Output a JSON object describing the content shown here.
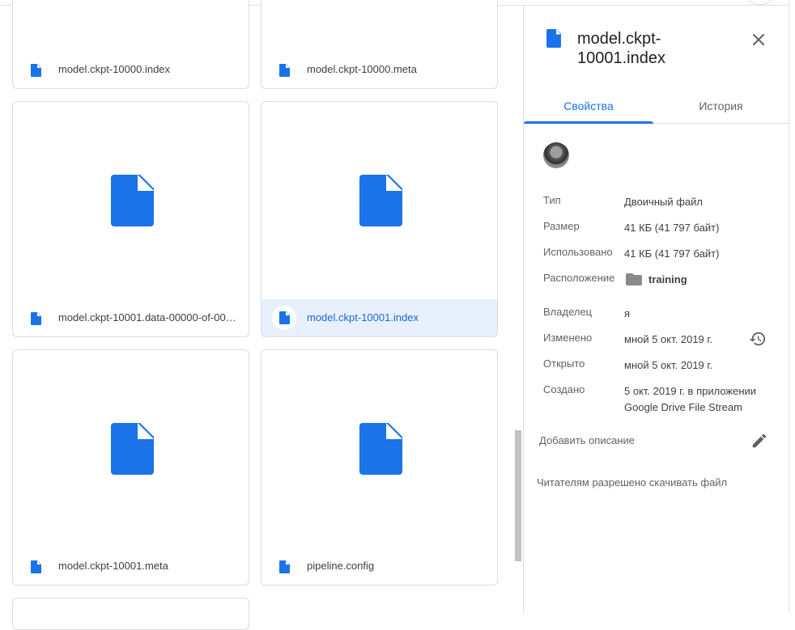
{
  "grid": {
    "files": [
      {
        "name": "model.ckpt-10000.index",
        "selected": false
      },
      {
        "name": "model.ckpt-10000.meta",
        "selected": false
      },
      {
        "name": "model.ckpt-10001.data-00000-of-00…",
        "selected": false
      },
      {
        "name": "model.ckpt-10001.index",
        "selected": true
      },
      {
        "name": "model.ckpt-10001.meta",
        "selected": false
      },
      {
        "name": "pipeline.config",
        "selected": false
      }
    ]
  },
  "details": {
    "title": "model.ckpt-10001.index",
    "tabs": {
      "properties": "Свойства",
      "history": "История"
    },
    "props": {
      "type_label": "Тип",
      "type_value": "Двоичный файл",
      "size_label": "Размер",
      "size_value": "41 КБ (41 797 байт)",
      "used_label": "Использовано",
      "used_value": "41 КБ (41 797 байт)",
      "location_label": "Расположение",
      "location_value": "training",
      "owner_label": "Владелец",
      "owner_value": "я",
      "modified_label": "Изменено",
      "modified_value": "мной 5 окт. 2019 г.",
      "opened_label": "Открыто",
      "opened_value": "мной 5 окт. 2019 г.",
      "created_label": "Создано",
      "created_value": "5 окт. 2019 г. в приложении Google Drive File Stream"
    },
    "add_description": "Добавить описание",
    "download_note": "Читателям разрешено скачивать файл"
  },
  "colors": {
    "accent": "#1a73e8",
    "doc_icon": "#1a73e8",
    "selected_bg": "#e8f0fe"
  },
  "icons": {
    "file": "doc-icon",
    "close": "close-icon",
    "history": "history-icon",
    "edit": "pencil-icon",
    "folder": "folder-icon",
    "avatar": "owner-avatar"
  }
}
